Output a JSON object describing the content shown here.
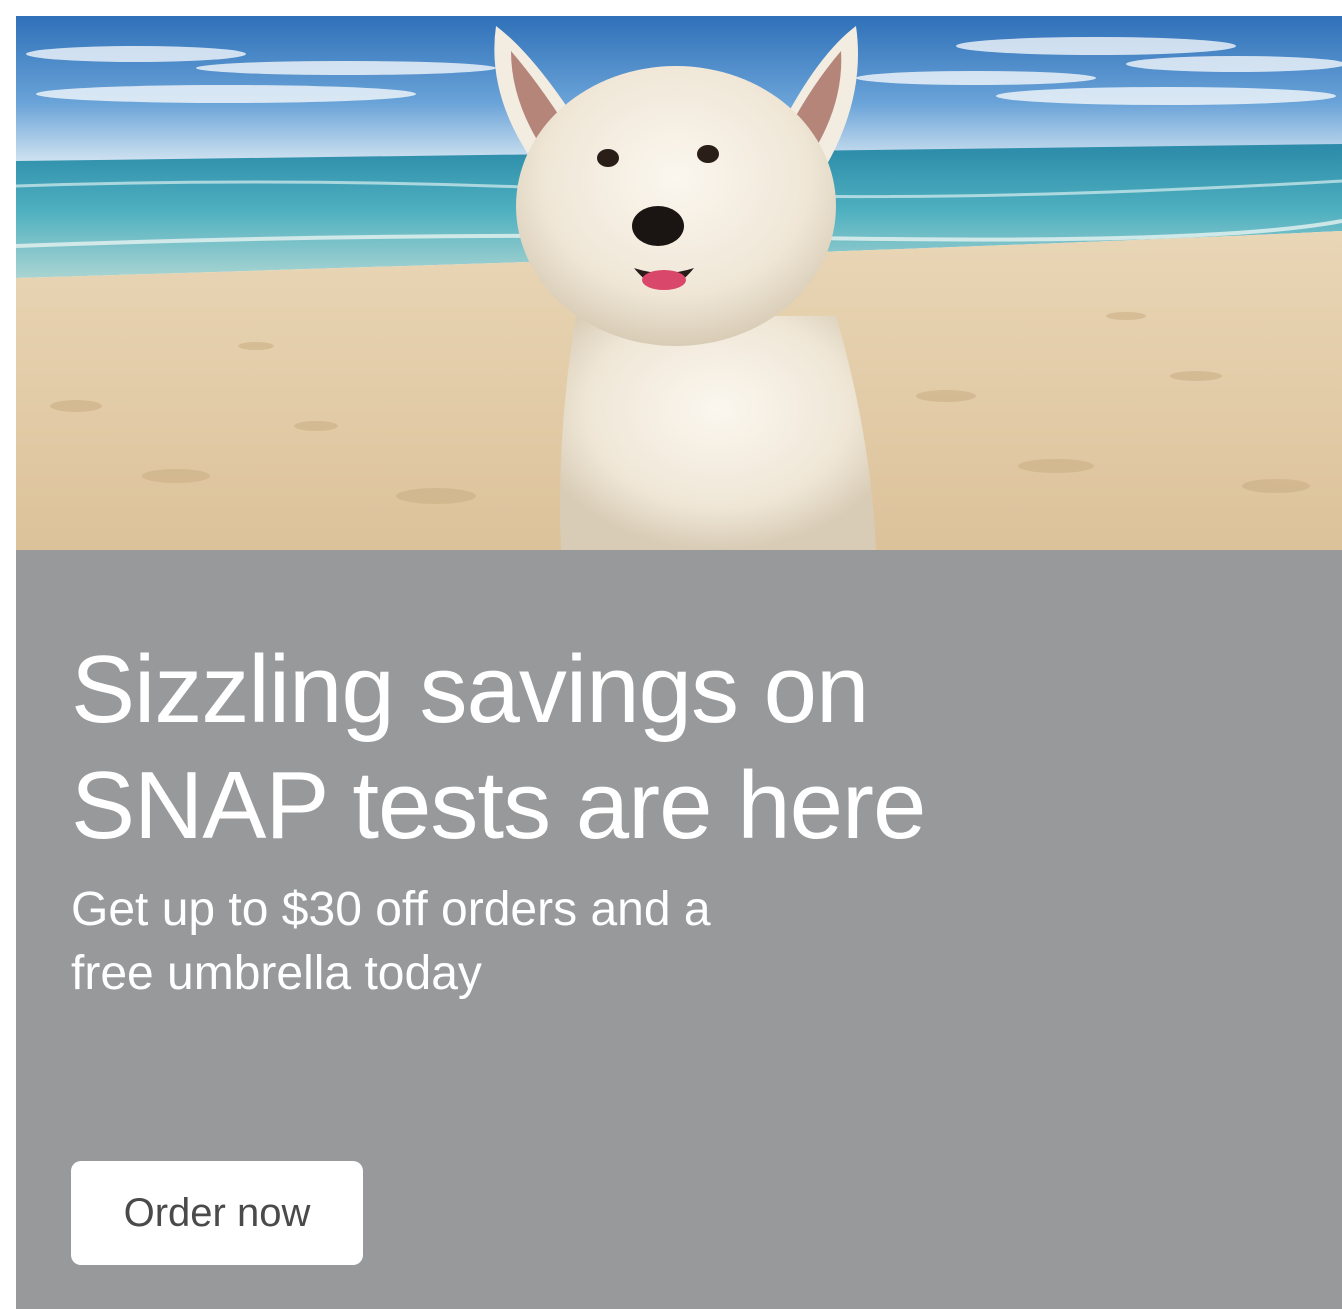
{
  "hero": {
    "image_subject": "white terrier dog on sandy beach with ocean and blue sky",
    "colors": {
      "sky": "#3e7fc2",
      "sea": "#3f9ab0",
      "sand": "#e8d4b4",
      "dog": "#f4efe6"
    }
  },
  "promo": {
    "headline_line1": "Sizzling savings on",
    "headline_line2": "SNAP tests are here",
    "subhead_line1": "Get up to $30 off orders and a",
    "subhead_line2": "free umbrella today",
    "cta_label": "Order now"
  },
  "colors": {
    "panel": "#98999b",
    "text": "#ffffff",
    "button_bg": "#ffffff",
    "button_text": "#4a4a4a"
  }
}
